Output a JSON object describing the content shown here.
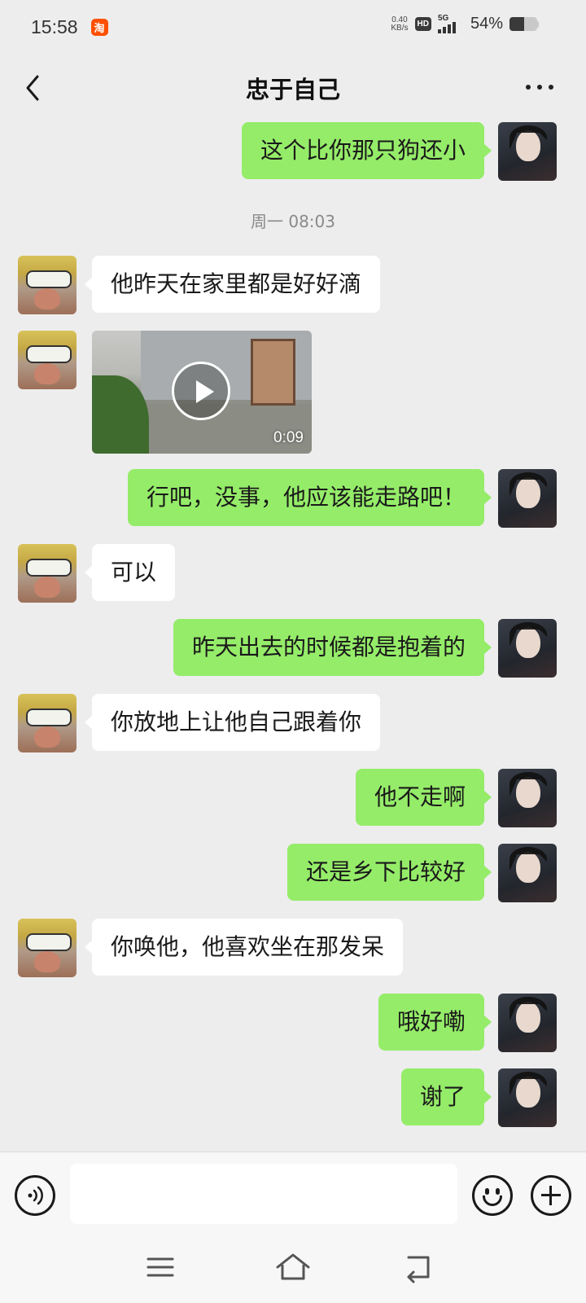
{
  "status_bar": {
    "time": "15:58",
    "app_badge": "淘",
    "net_speed_value": "0.40",
    "net_speed_unit": "KB/s",
    "hd_label": "HD",
    "network_label": "5G",
    "battery_text": "54%",
    "battery_level": 0.54
  },
  "header": {
    "title": "忠于自己",
    "back_icon": "chevron-left-icon",
    "more_icon": "more-dots-icon"
  },
  "messages": [
    {
      "side": "right",
      "type": "text",
      "text": "这个比你那只狗还小"
    },
    {
      "type": "timestamp",
      "text": "周一 08:03"
    },
    {
      "side": "left",
      "type": "text",
      "text": "他昨天在家里都是好好滴"
    },
    {
      "side": "left",
      "type": "video",
      "duration": "0:09"
    },
    {
      "side": "right",
      "type": "text",
      "text": "行吧，没事，他应该能走路吧！"
    },
    {
      "side": "left",
      "type": "text",
      "text": "可以"
    },
    {
      "side": "right",
      "type": "text",
      "text": "昨天出去的时候都是抱着的"
    },
    {
      "side": "left",
      "type": "text",
      "text": "你放地上让他自己跟着你"
    },
    {
      "side": "right",
      "type": "text",
      "text": "他不走啊"
    },
    {
      "side": "right",
      "type": "text",
      "text": "还是乡下比较好"
    },
    {
      "side": "left",
      "type": "text",
      "text": "你唤他，他喜欢坐在那发呆"
    },
    {
      "side": "right",
      "type": "text",
      "text": "哦好嘞"
    },
    {
      "side": "right",
      "type": "text",
      "text": "谢了"
    }
  ],
  "input_bar": {
    "voice_icon": "voice-icon",
    "input_value": "",
    "emoji_icon": "emoji-icon",
    "plus_icon": "plus-icon"
  },
  "system_nav": {
    "menu_icon": "menu-icon",
    "home_icon": "home-icon",
    "back_icon": "back-icon"
  },
  "colors": {
    "background": "#ededed",
    "self_bubble": "#95ec69",
    "other_bubble": "#ffffff"
  }
}
